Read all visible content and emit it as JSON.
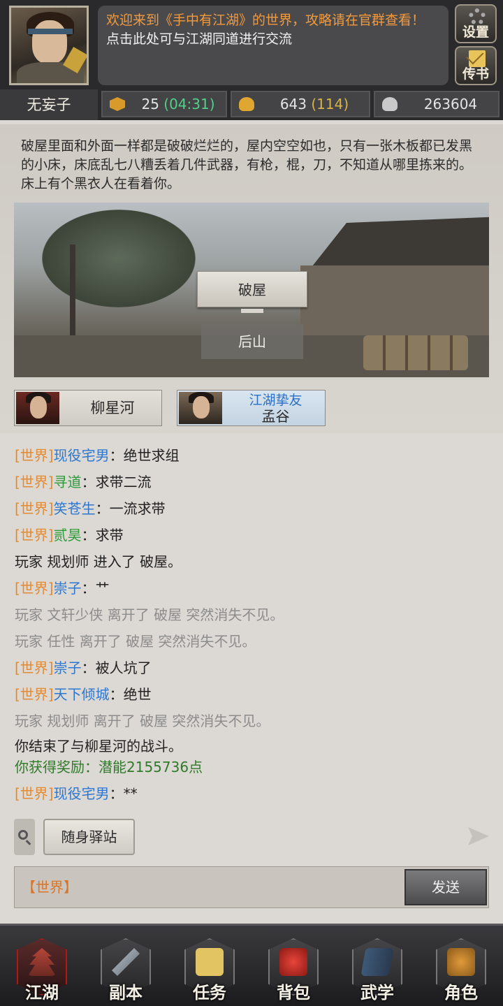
{
  "header": {
    "notice_line1": "欢迎来到《手中有江湖》的世界，攻略请在官群查看！",
    "notice_line2": "点击此处可与江湖同道进行交流",
    "settings_label": "设置",
    "mail_label": "传书",
    "player_name": "无妄子",
    "energy": {
      "value": "25",
      "timer": "(04:31)"
    },
    "gold": {
      "value": "643",
      "extra": "(114)"
    },
    "silver": {
      "value": "263604"
    }
  },
  "scene": {
    "description": "破屋里面和外面一样都是破破烂烂的，屋内空空如也，只有一张木板都已发黑的小床，床底乱七八糟丢着几件武器，有枪，棍，刀，不知道从哪里拣来的。床上有个黑衣人在看着你。",
    "current_location": "破屋",
    "exit_location": "后山",
    "npcs": [
      {
        "name": "柳星河"
      },
      {
        "title": "江湖挚友",
        "name": "孟谷"
      }
    ]
  },
  "chat": {
    "messages": [
      {
        "channel": "[世界]",
        "user": "现役宅男",
        "sep": "：",
        "text": "绝世求组"
      },
      {
        "channel": "[世界]",
        "user": "寻道",
        "sep": "：",
        "text": "求带二流"
      },
      {
        "channel": "[世界]",
        "user": "笑苍生",
        "sep": "：",
        "text": "一流求带"
      },
      {
        "channel": "[世界]",
        "user": "贰昊",
        "sep": "：",
        "text": "求带"
      },
      {
        "text": "玩家 规划师 进入了 破屋。"
      },
      {
        "channel": "[世界]",
        "user": "崇子",
        "sep": "：",
        "text": "艹"
      },
      {
        "text": "玩家 文轩少侠 离开了 破屋 突然消失不见。"
      },
      {
        "text": "玩家 任性 离开了 破屋 突然消失不见。"
      },
      {
        "channel": "[世界]",
        "user": "崇子",
        "sep": "：",
        "text": "被人坑了"
      },
      {
        "channel": "[世界]",
        "user": "天下倾城",
        "sep": "：",
        "text": "绝世"
      },
      {
        "text": "玩家 规划师 离开了 破屋 突然消失不见。"
      },
      {
        "text": "你结束了与柳星河的战斗。"
      },
      {
        "text": "你获得奖励：潜能2155736点"
      },
      {
        "channel": "[世界]",
        "user": "现役宅男",
        "sep": "：",
        "text": "**"
      }
    ],
    "station_label": "随身驿站",
    "input_channel": "【世界】",
    "input_value": "",
    "send_label": "发送"
  },
  "nav": {
    "items": [
      {
        "label": "江湖",
        "icon": "pagoda-icon"
      },
      {
        "label": "副本",
        "icon": "sword-icon"
      },
      {
        "label": "任务",
        "icon": "scroll-icon"
      },
      {
        "label": "背包",
        "icon": "bag-icon"
      },
      {
        "label": "武学",
        "icon": "book-icon"
      },
      {
        "label": "角色",
        "icon": "gourd-icon"
      }
    ]
  },
  "colors": {
    "channel": "#e28a32",
    "user_blue": "#2e77d0",
    "user_green": "#2f9a3a",
    "system_grey": "#8c8c8c",
    "reward_green": "#2f7a2a",
    "timer_green": "#52d08a",
    "gold_extra": "#d9b24a",
    "notice_orange": "#f39a3c"
  }
}
